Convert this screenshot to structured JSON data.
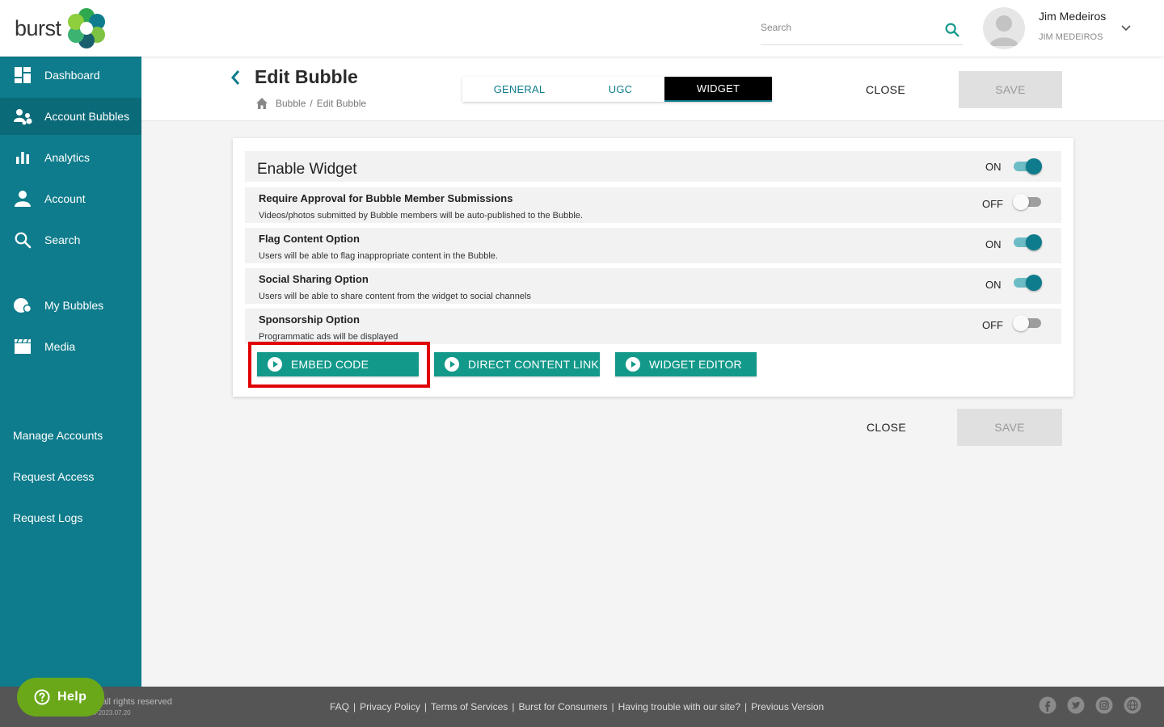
{
  "header": {
    "logo_text": "burst",
    "search_placeholder": "Search",
    "user_name": "Jim Medeiros",
    "user_account": "JIM MEDEIROS"
  },
  "sidebar": {
    "items": [
      {
        "label": "Dashboard",
        "icon": "dashboard-icon"
      },
      {
        "label": "Account Bubbles",
        "icon": "account-bubbles-icon",
        "active": true
      },
      {
        "label": "Analytics",
        "icon": "bar-chart-icon"
      },
      {
        "label": "Account",
        "icon": "person-icon"
      },
      {
        "label": "Search",
        "icon": "search-icon"
      },
      {
        "label": "My Bubbles",
        "icon": "bubble-icon"
      },
      {
        "label": "Media",
        "icon": "clapperboard-icon"
      }
    ],
    "links": [
      "Manage Accounts",
      "Request Access",
      "Request Logs"
    ]
  },
  "page": {
    "title": "Edit Bubble",
    "breadcrumb": [
      "Bubble",
      "/",
      "Edit Bubble"
    ],
    "tabs": [
      "GENERAL",
      "UGC",
      "WIDGET"
    ],
    "active_tab": "WIDGET",
    "close_label": "CLOSE",
    "save_label": "SAVE"
  },
  "widget_settings": {
    "enable": {
      "title": "Enable Widget",
      "state": "ON"
    },
    "options": [
      {
        "title": "Require Approval for Bubble Member Submissions",
        "desc": "Videos/photos submitted by Bubble members will be auto-published to the Bubble.",
        "state": "OFF"
      },
      {
        "title": "Flag Content Option",
        "desc": "Users will be able to flag inappropriate content in the Bubble.",
        "state": "ON"
      },
      {
        "title": "Social Sharing Option",
        "desc": "Users will be able to share content from the widget to social channels",
        "state": "ON"
      },
      {
        "title": "Sponsorship Option",
        "desc": "Programmatic ads will be displayed",
        "state": "OFF"
      }
    ],
    "actions": [
      "EMBED CODE",
      "DIRECT CONTENT LINK",
      "WIDGET EDITOR"
    ]
  },
  "footer": {
    "copyright": "all rights reserved",
    "version": "06-2023.07.20",
    "links": [
      "FAQ",
      "Privacy Policy",
      "Terms of Services",
      "Burst for Consumers",
      "Having trouble with our site?",
      "Previous Version"
    ],
    "socials": [
      "facebook-icon",
      "twitter-icon",
      "instagram-icon",
      "globe-icon"
    ],
    "help_label": "Help"
  },
  "colors": {
    "sidebar": "#0e7c8c",
    "accent_button": "#13998a",
    "highlight": "#e00000",
    "help": "#6aa81a"
  }
}
